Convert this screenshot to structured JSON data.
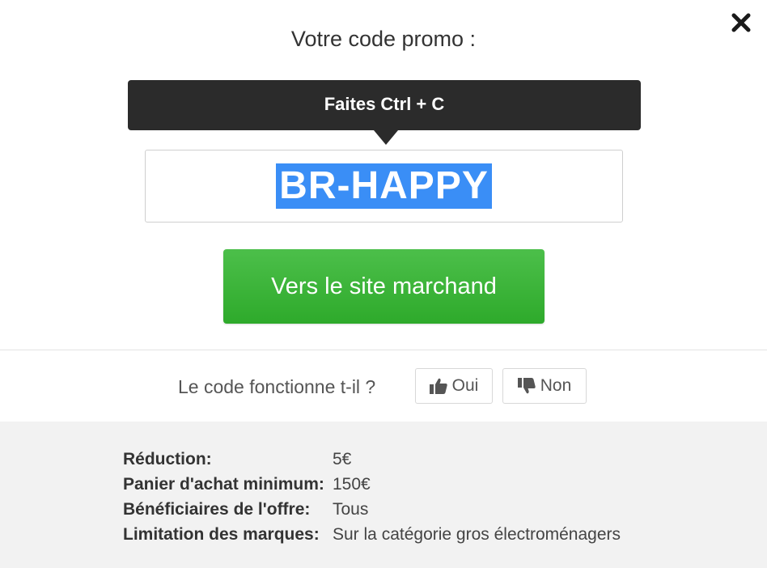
{
  "modal": {
    "title": "Votre code promo :",
    "close_icon": "close-icon"
  },
  "tooltip": {
    "text": "Faites Ctrl + C"
  },
  "code": {
    "value": "BR-HAPPY",
    "highlight_color": "#3a8ef6"
  },
  "merchant_button": {
    "label": "Vers le site marchand",
    "color": "#35ad32"
  },
  "feedback": {
    "question": "Le code fonctionne t-il ?",
    "yes_label": "Oui",
    "yes_icon": "thumbs-up-icon",
    "no_label": "Non",
    "no_icon": "thumbs-down-icon"
  },
  "details": [
    {
      "label": "Réduction:",
      "value": "5€"
    },
    {
      "label": "Panier d'achat minimum:",
      "value": "150€"
    },
    {
      "label": "Bénéficiaires de l'offre:",
      "value": "Tous"
    },
    {
      "label": "Limitation des marques:",
      "value": "Sur la catégorie gros électroménagers"
    }
  ]
}
